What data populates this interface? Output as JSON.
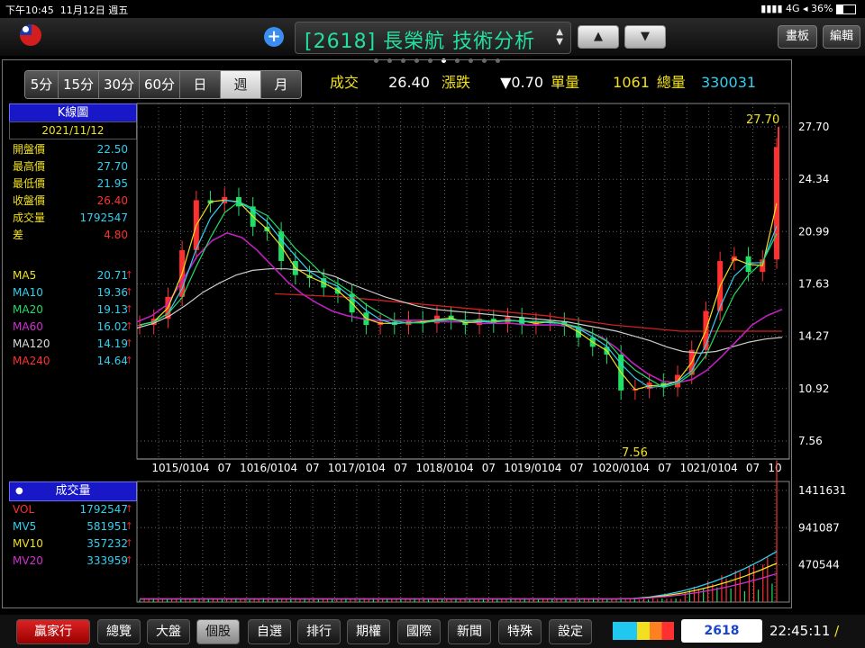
{
  "status": {
    "time": "下午10:45",
    "date": "11月12日 週五",
    "network": "4G",
    "battery": "36%"
  },
  "header": {
    "title": "[2618] 長榮航 技術分析",
    "btn_draw": "畫板",
    "btn_edit": "編輯"
  },
  "tabs": [
    "5分",
    "15分",
    "30分",
    "60分",
    "日",
    "週",
    "月"
  ],
  "selected_tab": "週",
  "quote": {
    "price_label": "成交",
    "price": "26.40",
    "chg_label": "漲跌",
    "chg": "▼0.70",
    "vol_label": "單量",
    "vol": "1061",
    "total_label": "總量",
    "total": "330031"
  },
  "kpanel": {
    "title": "K線圖",
    "date": "2021/11/12",
    "rows": [
      {
        "k": "開盤價",
        "v": "22.50",
        "color": "#30d0f0"
      },
      {
        "k": "最高價",
        "v": "27.70",
        "color": "#30d0f0"
      },
      {
        "k": "最低價",
        "v": "21.95",
        "color": "#30d0f0"
      },
      {
        "k": "收盤價",
        "v": "26.40",
        "color": "#ff3030"
      },
      {
        "k": "成交量",
        "v": "1792547",
        "color": "#30d0f0"
      },
      {
        "k": "差",
        "v": "4.80",
        "color": "#ff3030"
      }
    ],
    "ma": [
      {
        "k": "MA5",
        "v": "20.71",
        "color": "#f0e020"
      },
      {
        "k": "MA10",
        "v": "19.36",
        "color": "#30d0f0"
      },
      {
        "k": "MA20",
        "v": "19.13",
        "color": "#22dd66"
      },
      {
        "k": "MA60",
        "v": "16.02",
        "color": "#d030d0"
      },
      {
        "k": "MA120",
        "v": "14.19",
        "color": "#dddddd"
      },
      {
        "k": "MA240",
        "v": "14.64",
        "color": "#ff3030"
      }
    ]
  },
  "vpanel": {
    "title": "成交量",
    "rows": [
      {
        "k": "VOL",
        "v": "1792547",
        "color": "#ff3030"
      },
      {
        "k": "MV5",
        "v": "581951",
        "color": "#30d0f0"
      },
      {
        "k": "MV10",
        "v": "357232",
        "color": "#f0e020"
      },
      {
        "k": "MV20",
        "v": "333959",
        "color": "#d030d0"
      }
    ]
  },
  "chart_data": {
    "type": "line",
    "price_axis_ticks": [
      "27.70",
      "24.34",
      "20.99",
      "17.63",
      "14.27",
      "10.92",
      "7.56"
    ],
    "volume_axis_ticks": [
      "1411631",
      "941087",
      "470544"
    ],
    "x_tick_labels": [
      "10",
      "15/01",
      "04",
      "07",
      "10",
      "16/01",
      "04",
      "07",
      "10",
      "17/01",
      "04",
      "07",
      "10",
      "18/01",
      "04",
      "07",
      "10",
      "19/01",
      "04",
      "07",
      "10",
      "20/01",
      "04",
      "07",
      "10",
      "21/01",
      "04",
      "07",
      "10"
    ],
    "high_label": "27.70",
    "low_label": "7.56",
    "series_close_approx": [
      15.0,
      15.4,
      16.8,
      19.8,
      23.0,
      22.8,
      23.2,
      22.6,
      21.3,
      21.0,
      19.1,
      18.2,
      18.0,
      17.4,
      17.0,
      15.8,
      15.0,
      15.2,
      15.0,
      15.3,
      15.1,
      15.6,
      15.3,
      15.0,
      15.4,
      15.1,
      15.5,
      15.0,
      15.2,
      15.2,
      14.9,
      14.2,
      13.6,
      13.1,
      10.8,
      10.9,
      11.3,
      11.0,
      11.8,
      13.4,
      15.9,
      19.1,
      19.4,
      18.4,
      19.2,
      26.4
    ],
    "ma60_approx": [
      15.2,
      15.6,
      16.3,
      17.8,
      19.4,
      20.4,
      20.9,
      20.6,
      19.8,
      18.8,
      17.8,
      17.0,
      16.4,
      15.9,
      15.6,
      15.4,
      15.3,
      15.3,
      15.3,
      15.3,
      15.2,
      15.2,
      15.2,
      15.1,
      15.1,
      15.1,
      15.0,
      15.0,
      15.0,
      14.9,
      14.6,
      14.2,
      13.5,
      12.6,
      11.9,
      11.4,
      11.3,
      11.5,
      12.1,
      13.0,
      14.0,
      15.0,
      15.6,
      16.0
    ],
    "ma120_approx": [
      14.8,
      15.1,
      15.6,
      16.3,
      17.1,
      17.7,
      18.2,
      18.5,
      18.6,
      18.6,
      18.5,
      18.4,
      18.1,
      17.6,
      17.2,
      16.8,
      16.5,
      16.2,
      16.0,
      15.9,
      15.8,
      15.7,
      15.6,
      15.5,
      15.4,
      15.3,
      15.2,
      15.0,
      14.8,
      14.6,
      14.3,
      14.0,
      13.6,
      13.3,
      13.2,
      13.3,
      13.6,
      13.9,
      14.1,
      14.2
    ],
    "ma240_approx": [
      17.0,
      16.9,
      16.8,
      16.6,
      16.4,
      16.2,
      16.0,
      15.8,
      15.6,
      15.3,
      15.0,
      14.8,
      14.6,
      14.6,
      14.6,
      14.6
    ]
  },
  "nav": [
    "贏家行",
    "總覽",
    "大盤",
    "個股",
    "自選",
    "排行",
    "期權",
    "國際",
    "新聞",
    "特殊",
    "設定"
  ],
  "nav_selected": "個股",
  "code": "2618",
  "clock": "22:45:11"
}
